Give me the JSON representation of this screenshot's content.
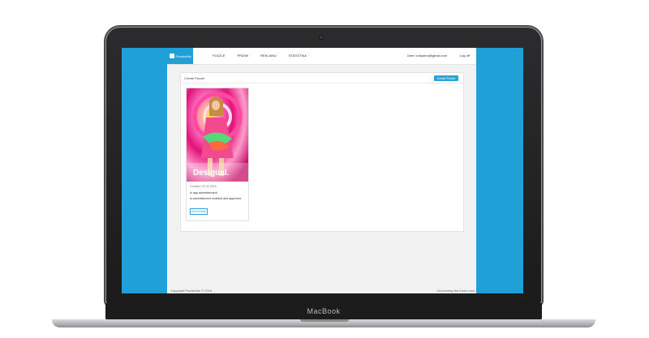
{
  "device": {
    "brand": "MacBook"
  },
  "app": {
    "logo_text": "PuzzleAds",
    "nav": [
      "PUZZLE",
      "PRIZMI",
      "REKLAMU",
      "STATISTIKA"
    ],
    "user": "User: lorikpena@gmail.com",
    "logout": "Log off"
  },
  "panel": {
    "title": "Create Puzzle",
    "create_button": "Create Puzzle"
  },
  "card": {
    "brand_logo": "Desigual.",
    "date": "Created: 02.02.2016",
    "line1": "In app advertisement",
    "line2": "Is advertisement enabled and approved",
    "line3": "",
    "button": "View Details"
  },
  "footer": {
    "left": "Copyright PuzzleAds © 2015",
    "right": "Uncovering the future now"
  },
  "colors": {
    "accent": "#1fa0d6",
    "button": "#2aa3d9"
  }
}
